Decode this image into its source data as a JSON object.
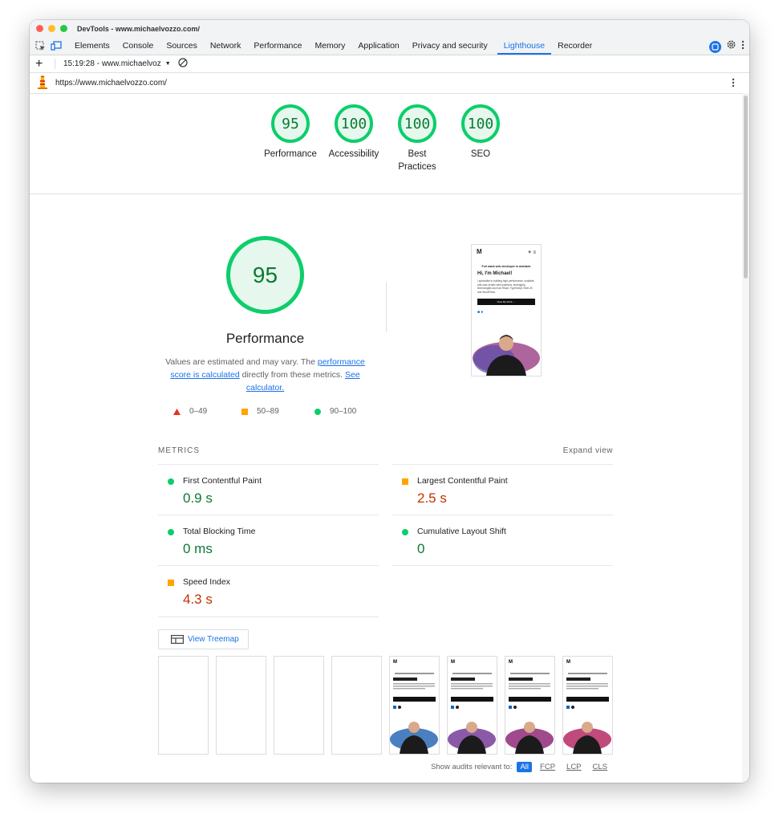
{
  "window": {
    "title": "DevTools - www.michaelvozzo.com/"
  },
  "tabs": [
    {
      "label": "Elements"
    },
    {
      "label": "Console"
    },
    {
      "label": "Sources"
    },
    {
      "label": "Network"
    },
    {
      "label": "Performance"
    },
    {
      "label": "Memory"
    },
    {
      "label": "Application"
    },
    {
      "label": "Privacy and security"
    },
    {
      "label": "Lighthouse"
    },
    {
      "label": "Recorder"
    }
  ],
  "toolbar": {
    "add": "+",
    "report_selector": "15:19:28 - www.michaelvoz"
  },
  "url": "https://www.michaelvozzo.com/",
  "categories": [
    {
      "score": "95",
      "label": "Performance"
    },
    {
      "score": "100",
      "label": "Accessibility"
    },
    {
      "score": "100",
      "label": "Best Practices"
    },
    {
      "score": "100",
      "label": "SEO"
    }
  ],
  "performance": {
    "score": "95",
    "title": "Performance",
    "desc_pre": "Values are estimated and may vary. The ",
    "desc_link1": "performance score is calculated",
    "desc_mid": " directly from these metrics. ",
    "desc_link2": "See calculator."
  },
  "legend": [
    {
      "range": "0–49",
      "color": "#e8331e"
    },
    {
      "range": "50–89",
      "color": "#ffa400"
    },
    {
      "range": "90–100",
      "color": "#0cce6b"
    }
  ],
  "metrics": {
    "heading": "METRICS",
    "expand": "Expand view",
    "items": [
      {
        "name": "First Contentful Paint",
        "value": "0.9 s",
        "status": "good"
      },
      {
        "name": "Largest Contentful Paint",
        "value": "2.5 s",
        "status": "average"
      },
      {
        "name": "Total Blocking Time",
        "value": "0 ms",
        "status": "good"
      },
      {
        "name": "Cumulative Layout Shift",
        "value": "0",
        "status": "good"
      },
      {
        "name": "Speed Index",
        "value": "4.3 s",
        "status": "average"
      }
    ]
  },
  "treemap": {
    "label": "View Treemap"
  },
  "phone_preview": {
    "logo": "M",
    "tagline": "Full stack web developer in Adelaide",
    "heading": "Hi, I'm Michael!",
    "body": "I specialise in building high-performance, scalable, and user-centric web solutions, leveraging technologies such as React, TypeScript, Next.JS and WordPress.",
    "button": "View My Work →"
  },
  "audits_filter": {
    "label": "Show audits relevant to:",
    "options": [
      "All",
      "FCP",
      "LCP",
      "CLS"
    ]
  },
  "colors": {
    "accent": "#1a73e8",
    "good": "#0cce6b",
    "good_text": "#0a7a33",
    "average": "#ffa400",
    "average_text": "#c33300"
  }
}
